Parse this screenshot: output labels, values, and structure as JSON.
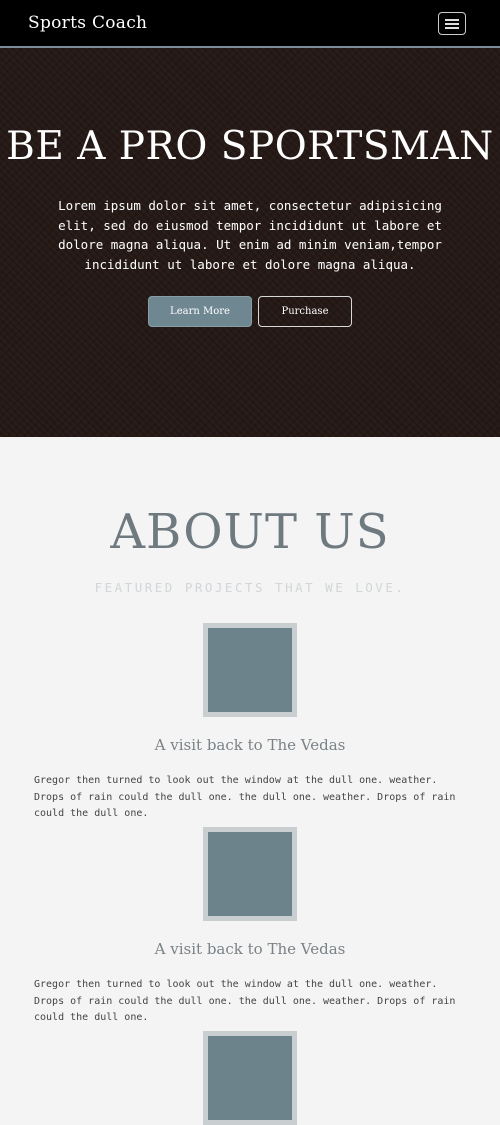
{
  "navbar": {
    "brand": "Sports Coach",
    "menu_icon": "hamburger-menu-icon"
  },
  "hero": {
    "title": "BE A PRO SPORTSMAN",
    "text": "Lorem ipsum dolor sit amet, consectetur adipisicing elit, sed do eiusmod tempor incididunt ut labore et dolore magna aliqua. Ut enim ad minim veniam,tempor incididunt ut labore et dolore magna aliqua.",
    "learn_more": "Learn More",
    "purchase": "Purchase"
  },
  "about": {
    "title": "ABOUT US",
    "subtitle": "FEATURED PROJECTS THAT WE LOVE.",
    "features": [
      {
        "title": "A visit back to The Vedas",
        "text": "Gregor then turned to look out the window at the dull one. weather. Drops of rain could the dull one. the dull one. weather. Drops of rain could the dull one."
      },
      {
        "title": "A visit back to The Vedas",
        "text": "Gregor then turned to look out the window at the dull one. weather. Drops of rain could the dull one. the dull one. weather. Drops of rain could the dull one."
      },
      {
        "title": "",
        "text": ""
      }
    ]
  },
  "colors": {
    "navbar_bg": "#000000",
    "hero_bg": "#251916",
    "accent": "#6f8791",
    "page_bg": "#f4f4f4"
  }
}
